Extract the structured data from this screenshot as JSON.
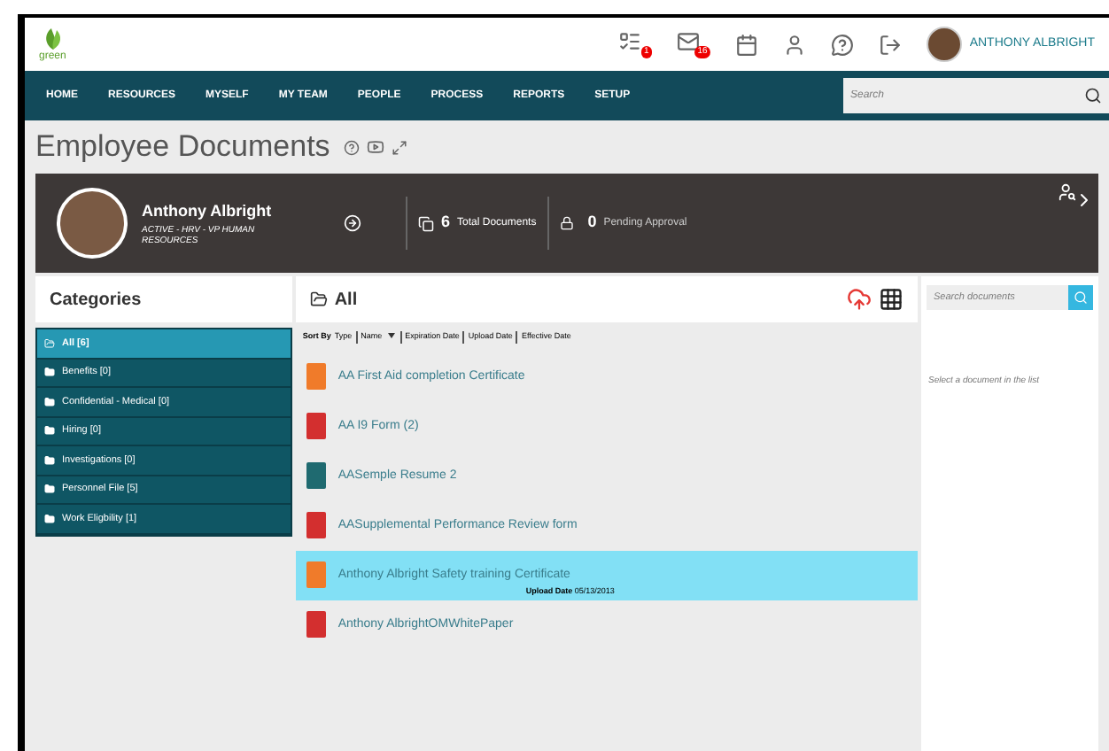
{
  "header": {
    "logo_text": "green",
    "icons": [
      {
        "kind": "tasks",
        "badge": "1"
      },
      {
        "kind": "mail",
        "badge": "16"
      },
      {
        "kind": "calendar"
      },
      {
        "kind": "person"
      },
      {
        "kind": "help"
      },
      {
        "kind": "logout"
      }
    ],
    "user_name": "ANTHONY ALBRIGHT"
  },
  "nav": {
    "items": [
      "HOME",
      "RESOURCES",
      "MYSELF",
      "MY TEAM",
      "PEOPLE",
      "PROCESS",
      "REPORTS",
      "SETUP"
    ],
    "search_placeholder": "Search"
  },
  "page_title": "Employee Documents",
  "profile": {
    "name": "Anthony Albright",
    "subtitle": "ACTIVE - HRV - VP HUMAN RESOURCES",
    "total_count": "6",
    "total_label": "Total Documents",
    "pending_count": "0",
    "pending_label": "Pending Approval"
  },
  "categories": {
    "title": "Categories",
    "items": [
      {
        "label": "All [6]",
        "selected": true
      },
      {
        "label": "Benefits [0]",
        "selected": false
      },
      {
        "label": "Confidential - Medical [0]",
        "selected": false
      },
      {
        "label": "Hiring [0]",
        "selected": false
      },
      {
        "label": "Investigations [0]",
        "selected": false
      },
      {
        "label": "Personnel File [5]",
        "selected": false
      },
      {
        "label": "Work Eligbility [1]",
        "selected": false
      }
    ]
  },
  "documents": {
    "title": "All",
    "sort_label": "Sort By",
    "sort_options": [
      {
        "label": "Type",
        "selected": false
      },
      {
        "label": "Name",
        "selected": true
      },
      {
        "label": "Expiration Date",
        "selected": false
      },
      {
        "label": "Upload Date",
        "selected": false
      },
      {
        "label": "Effective Date",
        "selected": false
      }
    ],
    "items": [
      {
        "kind": "cert",
        "name": "AA First Aid completion Certificate",
        "selected": false
      },
      {
        "kind": "pdf",
        "name": "AA I9 Form (2)",
        "selected": false
      },
      {
        "kind": "doc",
        "name": "AASemple Resume 2",
        "selected": false
      },
      {
        "kind": "pdf",
        "name": "AASupplemental Performance Review form",
        "selected": false
      },
      {
        "kind": "cert",
        "name": "Anthony Albright Safety training Certificate",
        "selected": true,
        "upload_label": "Upload Date",
        "upload_date": "05/13/2013"
      },
      {
        "kind": "pdf",
        "name": "Anthony AlbrightOMWhitePaper",
        "selected": false
      }
    ]
  },
  "preview": {
    "search_placeholder": "Search documents",
    "empty_text": "Select a document in the list"
  }
}
